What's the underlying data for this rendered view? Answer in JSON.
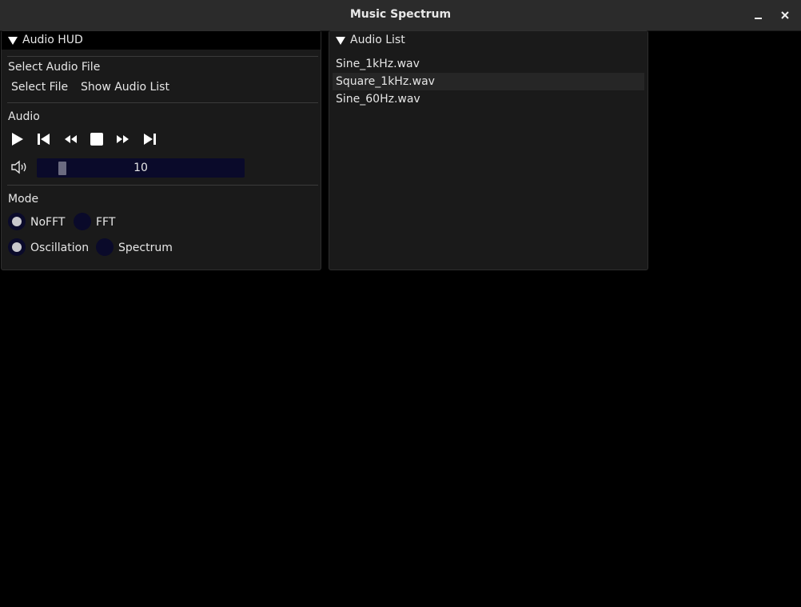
{
  "window": {
    "title": "Music Spectrum",
    "minimize_glyph": "–",
    "close_glyph": "✕"
  },
  "audio_hud": {
    "title": "Audio HUD",
    "select_section_label": "Select Audio File",
    "select_file_button": "Select File",
    "show_list_button": "Show Audio List",
    "audio_section_label": "Audio",
    "transport_icons": [
      "play-icon",
      "skip-back-icon",
      "rewind-icon",
      "stop-icon",
      "fast-forward-icon",
      "skip-forward-icon"
    ],
    "volume": {
      "icon": "speaker-icon",
      "value": "10"
    },
    "mode_section_label": "Mode",
    "mode_options": [
      {
        "label": "NoFFT",
        "selected": true
      },
      {
        "label": "FFT",
        "selected": false
      }
    ],
    "view_options": [
      {
        "label": "Oscillation",
        "selected": true
      },
      {
        "label": "Spectrum",
        "selected": false
      }
    ]
  },
  "audio_list": {
    "title": "Audio List",
    "items": [
      "Sine_1kHz.wav",
      "Square_1kHz.wav",
      "Sine_60Hz.wav"
    ],
    "hovered_index": 1
  },
  "colors": {
    "background": "#000000",
    "panel": "#1a1a1a",
    "widget_bg": "#0a0a2a",
    "radio_dot": "#c8c8cc",
    "slider_grab": "#6b6b80"
  }
}
